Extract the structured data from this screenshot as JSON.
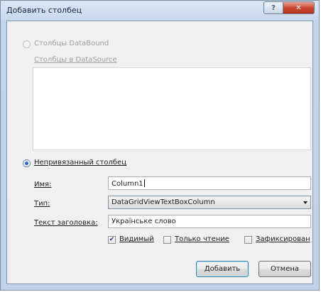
{
  "window": {
    "title": "Добавить столбец"
  },
  "titlebar": {
    "help": "?",
    "close": "✕"
  },
  "databound_option": {
    "label": "Столбцы DataBound",
    "checked": false,
    "enabled": false,
    "datasource_label": "Столбцы в DataSource"
  },
  "unbound_option": {
    "label": "Непривязанный столбец",
    "checked": true
  },
  "fields": {
    "name_label": "Имя:",
    "name_value": "Column1",
    "type_label": "Тип:",
    "type_value": "DataGridViewTextBoxColumn",
    "header_label": "Текст заголовка:",
    "header_value": "Українське слово"
  },
  "checkboxes": {
    "visible": {
      "label": "Видимый",
      "checked": true
    },
    "readonly": {
      "label": "Только чтение",
      "checked": false
    },
    "frozen": {
      "label": "Зафиксирован",
      "checked": false
    }
  },
  "buttons": {
    "add": "Добавить",
    "cancel": "Отмена"
  }
}
